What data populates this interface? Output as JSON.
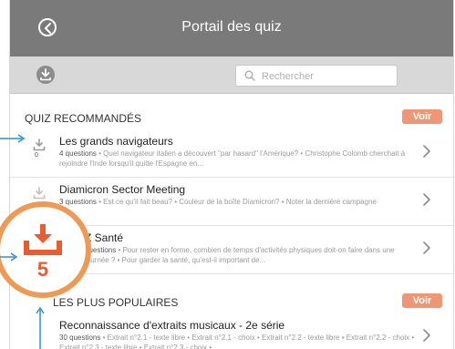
{
  "nav": {
    "title": "Portail des quiz"
  },
  "toolbar": {
    "search_placeholder": "Rechercher"
  },
  "sections": [
    {
      "title": "QUIZ RECOMMANDÉS",
      "voir_label": "Voir"
    },
    {
      "title": "QUIZ LES PLUS POPULAIRES",
      "visible_title": "LES PLUS POPULAIRES",
      "voir_label": "Voir"
    }
  ],
  "rows": [
    {
      "title": "Les grands navigateurs",
      "questions": "4 questions",
      "desc": " • Quel navigateur italien a découvert \"par hasard\" l'Amérique? • Christophe Colomb cherchait à rejoindre l'Inde lorsqu'il quitte l'Espagne en...",
      "count": "0"
    },
    {
      "title": "Diamicron Sector Meeting",
      "questions": "3 questions",
      "desc": " • Est ce qu'il fait beau? • Couleur de la boîte Diamicron? • Noter la dernière campagne",
      "count": ""
    },
    {
      "title": "Quiz Santé",
      "visible_title": "Z Santé",
      "questions": "3 questions",
      "visible_questions": "questions",
      "desc": " • Pour rester en forme, combien de temps d'activités physiques doit-on faire dans une journée ? • Pour garder la santé, qu'est-il important de...",
      "visible_desc": "on faire dans une journée ? • Pour garder la santé, qu'est-il important de...",
      "count": ""
    },
    {
      "title": "Reconnaissance d'extraits musicaux - 2e série",
      "questions": "30 questions",
      "desc": " • Extrait n°2.1 - texte libre • Extrait n°2.1 - choix • Extrait n°2.2 - texte libre • Extrait n°2.2 - choix • Extrait n°2.3 - texte libre • Extrait n°2.3 - choix •",
      "count": ""
    }
  ],
  "callout": {
    "count": "5"
  },
  "colors": {
    "navbar": "#7a7a7a",
    "accent": "#ee9675",
    "callout_ring": "#ee9a55",
    "callout_icon": "#e85c32",
    "annotation": "#2f8fd0"
  }
}
